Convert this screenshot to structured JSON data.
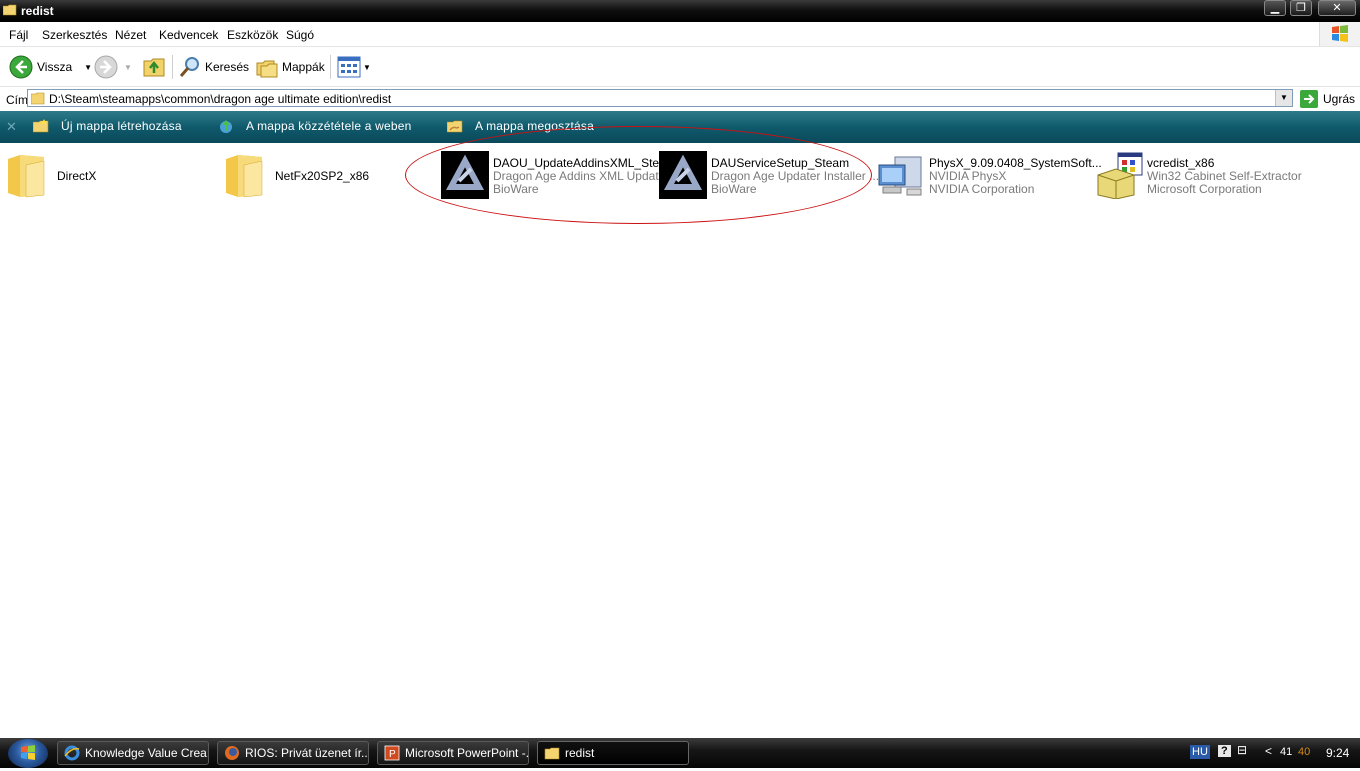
{
  "window": {
    "title": "redist"
  },
  "menu": [
    "Fájl",
    "Szerkesztés",
    "Nézet",
    "Kedvencek",
    "Eszközök",
    "Súgó"
  ],
  "toolbar": {
    "back_label": "Vissza",
    "search_label": "Keresés",
    "folders_label": "Mappák"
  },
  "address": {
    "label": "Cím",
    "path": "D:\\Steam\\steamapps\\common\\dragon age ultimate edition\\redist",
    "go_label": "Ugrás"
  },
  "tasks": [
    "Új mappa létrehozása",
    "A mappa közzététele a weben",
    "A mappa megosztása"
  ],
  "files": [
    {
      "name": "DirectX",
      "type": "folder"
    },
    {
      "name": "NetFx20SP2_x86",
      "type": "folder"
    },
    {
      "name": "DAOU_UpdateAddinsXML_Steam",
      "desc": "Dragon Age Addins XML Updater",
      "company": "BioWare",
      "type": "bioware"
    },
    {
      "name": "DAUServiceSetup_Steam",
      "desc": "Dragon Age Updater Installer ...",
      "company": "BioWare",
      "type": "bioware"
    },
    {
      "name": "PhysX_9.09.0408_SystemSoft...",
      "desc": "NVIDIA PhysX",
      "company": "NVIDIA Corporation",
      "type": "installer"
    },
    {
      "name": "vcredist_x86",
      "desc": "Win32 Cabinet Self-Extractor",
      "company": "Microsoft Corporation",
      "type": "setup"
    }
  ],
  "taskbar": {
    "windows": [
      "Knowledge Value Crea...",
      "RIOS: Privát üzenet ír...",
      "Microsoft PowerPoint -...",
      "redist"
    ],
    "tray": {
      "language": "HU",
      "help": "?",
      "num1": "41",
      "num2": "40",
      "time": "9:24"
    }
  },
  "colors": {
    "task_pane": "#0f5a6c",
    "highlight_ellipse": "#cc1111",
    "tray_num2": "#d08a1a"
  }
}
